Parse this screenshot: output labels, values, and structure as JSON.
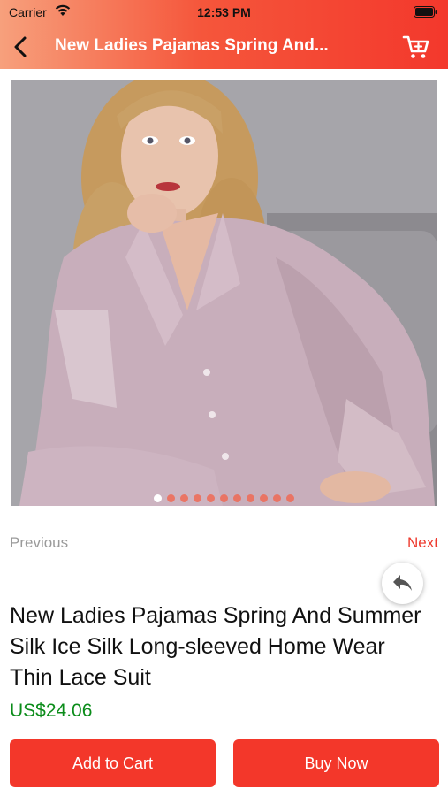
{
  "status_bar": {
    "carrier": "Carrier",
    "time": "12:53 PM"
  },
  "nav": {
    "title": "New Ladies Pajamas Spring And..."
  },
  "gallery": {
    "image_count": 11,
    "active_index": 0
  },
  "pager": {
    "previous_label": "Previous",
    "next_label": "Next"
  },
  "product": {
    "title": "New Ladies Pajamas Spring And Summer Silk Ice Silk Long-sleeved Home Wear Thin Lace Suit",
    "price": "US$24.06"
  },
  "actions": {
    "add_to_cart_label": "Add to Cart",
    "buy_now_label": "Buy Now"
  },
  "colors": {
    "accent": "#f3372a",
    "price": "#0b8c1a",
    "muted": "#9a9a9a"
  }
}
